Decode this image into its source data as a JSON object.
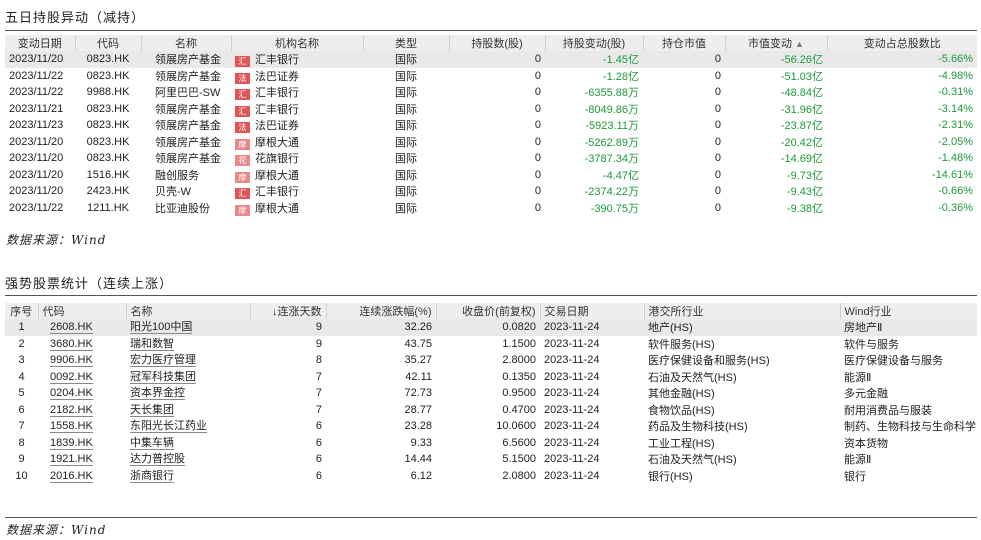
{
  "section1": {
    "title": "五日持股异动（减持）",
    "headers": [
      "变动日期",
      "代码",
      "名称",
      "机构名称",
      "类型",
      "持股数(股)",
      "持股变动(股)",
      "持仓市值",
      "市值变动",
      "变动占总股数比"
    ],
    "sort_icon": "▲",
    "rows": [
      {
        "date": "2023/11/20",
        "code": "0823.HK",
        "name": "领展房产基金",
        "tag": "汇",
        "org": "汇丰银行",
        "type": "国际",
        "shares": "0",
        "chg": "-1.45亿",
        "mv": "0",
        "mvchg": "-56.26亿",
        "pct": "-5.66%"
      },
      {
        "date": "2023/11/22",
        "code": "0823.HK",
        "name": "领展房产基金",
        "tag": "法",
        "org": "法巴证券",
        "type": "国际",
        "shares": "0",
        "chg": "-1.28亿",
        "mv": "0",
        "mvchg": "-51.03亿",
        "pct": "-4.98%"
      },
      {
        "date": "2023/11/22",
        "code": "9988.HK",
        "name": "阿里巴巴-SW",
        "tag": "汇",
        "org": "汇丰银行",
        "type": "国际",
        "shares": "0",
        "chg": "-6355.88万",
        "mv": "0",
        "mvchg": "-48.84亿",
        "pct": "-0.31%"
      },
      {
        "date": "2023/11/21",
        "code": "0823.HK",
        "name": "领展房产基金",
        "tag": "汇",
        "org": "汇丰银行",
        "type": "国际",
        "shares": "0",
        "chg": "-8049.86万",
        "mv": "0",
        "mvchg": "-31.96亿",
        "pct": "-3.14%"
      },
      {
        "date": "2023/11/23",
        "code": "0823.HK",
        "name": "领展房产基金",
        "tag": "法",
        "org": "法巴证券",
        "type": "国际",
        "shares": "0",
        "chg": "-5923.11万",
        "mv": "0",
        "mvchg": "-23.87亿",
        "pct": "-2.31%"
      },
      {
        "date": "2023/11/20",
        "code": "0823.HK",
        "name": "领展房产基金",
        "tag": "摩",
        "org": "摩根大通",
        "type": "国际",
        "shares": "0",
        "chg": "-5262.89万",
        "mv": "0",
        "mvchg": "-20.42亿",
        "pct": "-2.05%"
      },
      {
        "date": "2023/11/20",
        "code": "0823.HK",
        "name": "领展房产基金",
        "tag": "花",
        "org": "花旗银行",
        "type": "国际",
        "shares": "0",
        "chg": "-3787.34万",
        "mv": "0",
        "mvchg": "-14.69亿",
        "pct": "-1.48%"
      },
      {
        "date": "2023/11/20",
        "code": "1516.HK",
        "name": "融创服务",
        "tag": "摩",
        "org": "摩根大通",
        "type": "国际",
        "shares": "0",
        "chg": "-4.47亿",
        "mv": "0",
        "mvchg": "-9.73亿",
        "pct": "-14.61%"
      },
      {
        "date": "2023/11/20",
        "code": "2423.HK",
        "name": "贝壳-W",
        "tag": "汇",
        "org": "汇丰银行",
        "type": "国际",
        "shares": "0",
        "chg": "-2374.22万",
        "mv": "0",
        "mvchg": "-9.43亿",
        "pct": "-0.66%"
      },
      {
        "date": "2023/11/22",
        "code": "1211.HK",
        "name": "比亚迪股份",
        "tag": "摩",
        "org": "摩根大通",
        "type": "国际",
        "shares": "0",
        "chg": "-390.75万",
        "mv": "0",
        "mvchg": "-9.38亿",
        "pct": "-0.36%"
      }
    ],
    "source": "数据来源：Wind"
  },
  "section2": {
    "title": "强势股票统计（连续上涨）",
    "headers": [
      "序号",
      "代码",
      "名称",
      "连涨天数",
      "连续涨跌幅(%)",
      "收盘价(前复权)",
      "交易日期",
      "港交所行业",
      "Wind行业"
    ],
    "sort_arrow": "↓",
    "rows": [
      {
        "n": "1",
        "code": "2608.HK",
        "name": "阳光100中国",
        "days": "9",
        "pct": "32.26",
        "close": "0.0820",
        "date": "2023-11-24",
        "hk": "地产(HS)",
        "wind": "房地产Ⅱ"
      },
      {
        "n": "2",
        "code": "3680.HK",
        "name": "瑞和数智",
        "days": "9",
        "pct": "43.75",
        "close": "1.1500",
        "date": "2023-11-24",
        "hk": "软件服务(HS)",
        "wind": "软件与服务"
      },
      {
        "n": "3",
        "code": "9906.HK",
        "name": "宏力医疗管理",
        "days": "8",
        "pct": "35.27",
        "close": "2.8000",
        "date": "2023-11-24",
        "hk": "医疗保健设备和服务(HS)",
        "wind": "医疗保健设备与服务"
      },
      {
        "n": "4",
        "code": "0092.HK",
        "name": "冠军科技集团",
        "days": "7",
        "pct": "42.11",
        "close": "0.1350",
        "date": "2023-11-24",
        "hk": "石油及天然气(HS)",
        "wind": "能源Ⅱ"
      },
      {
        "n": "5",
        "code": "0204.HK",
        "name": "资本界金控",
        "days": "7",
        "pct": "72.73",
        "close": "0.9500",
        "date": "2023-11-24",
        "hk": "其他金融(HS)",
        "wind": "多元金融"
      },
      {
        "n": "6",
        "code": "2182.HK",
        "name": "天长集团",
        "days": "7",
        "pct": "28.77",
        "close": "0.4700",
        "date": "2023-11-24",
        "hk": "食物饮品(HS)",
        "wind": "耐用消费品与服装"
      },
      {
        "n": "7",
        "code": "1558.HK",
        "name": "东阳光长江药业",
        "days": "6",
        "pct": "23.28",
        "close": "10.0600",
        "date": "2023-11-24",
        "hk": "药品及生物科技(HS)",
        "wind": "制药、生物科技与生命科学"
      },
      {
        "n": "8",
        "code": "1839.HK",
        "name": "中集车辆",
        "days": "6",
        "pct": "9.33",
        "close": "6.5600",
        "date": "2023-11-24",
        "hk": "工业工程(HS)",
        "wind": "资本货物"
      },
      {
        "n": "9",
        "code": "1921.HK",
        "name": "达力普控股",
        "days": "6",
        "pct": "14.44",
        "close": "5.1500",
        "date": "2023-11-24",
        "hk": "石油及天然气(HS)",
        "wind": "能源Ⅱ"
      },
      {
        "n": "10",
        "code": "2016.HK",
        "name": "浙商银行",
        "days": "6",
        "pct": "6.12",
        "close": "2.0800",
        "date": "2023-11-24",
        "hk": "银行(HS)",
        "wind": "银行"
      }
    ],
    "source": "数据来源：Wind"
  }
}
